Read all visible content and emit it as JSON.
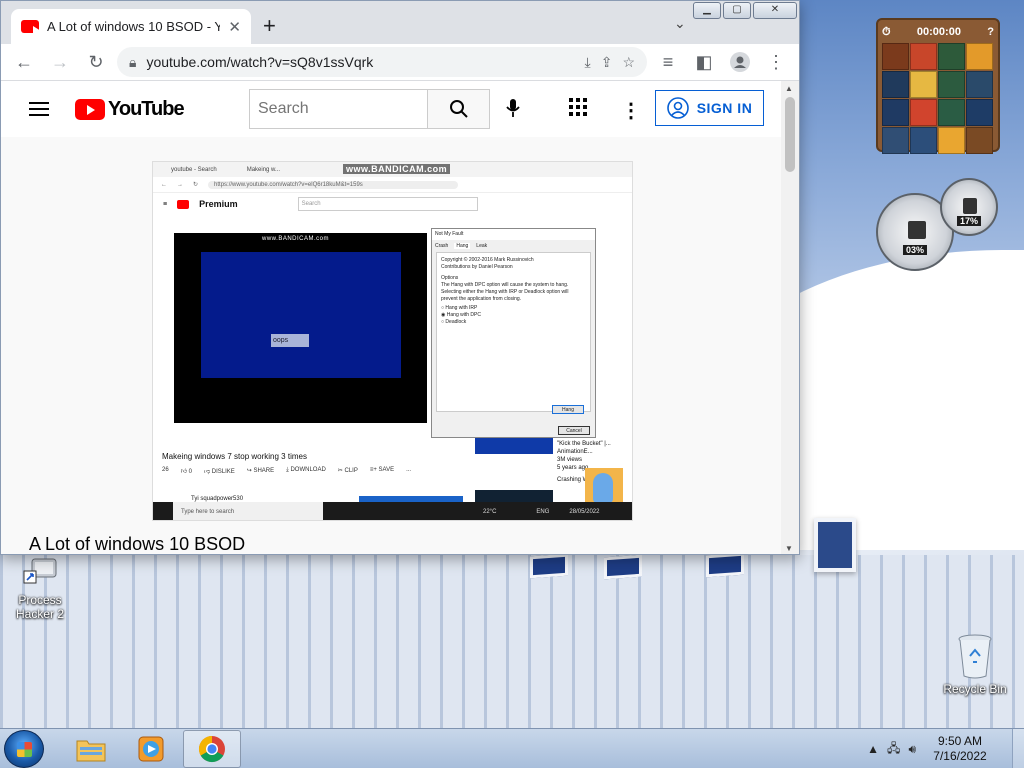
{
  "browser": {
    "tab_title": "A Lot of windows 10 BSOD - You",
    "tab_close": "✕",
    "new_tab": "+",
    "url": "youtube.com/watch?v=sQ8v1ssVqrk",
    "window_controls": {
      "minimize": "▁",
      "maximize": "▢",
      "close": "✕"
    }
  },
  "youtube": {
    "logo_text": "YouTube",
    "search_placeholder": "Search",
    "sign_in": "SIGN IN",
    "video_title": "A Lot of windows 10 BSOD"
  },
  "video_frame": {
    "watermark_top": "www.BANDICAM.com",
    "watermark_player": "www.BANDICAM.com",
    "tab1": "youtube - Search",
    "tab2": "Makeing w...",
    "inner_url": "https://www.youtube.com/watch?v=elQ6r18kuM&t=159s",
    "premium": "Premium",
    "inner_search": "Search",
    "oops": "oops",
    "dialog_title": "Not My Fault",
    "dialog_tabs": [
      "Crash",
      "Hang",
      "Leak"
    ],
    "dialog_text1": "Copyright © 2002-2016 Mark Russinovich",
    "dialog_text2": "Contributions by Daniel Pearson",
    "dialog_options": "Options",
    "dialog_desc": "The Hang with DPC option will cause the system to hang. Selecting either the Hang with IRP or Deadlock option will prevent the application from closing.",
    "dialog_radio1": "Hang with IRP",
    "dialog_radio2": "Hang with DPC",
    "dialog_radio3": "Deadlock",
    "dialog_hang_btn": "Hang",
    "dialog_cancel_btn": "Cancel",
    "caption": "Makeing windows 7 stop working 3 times",
    "actions": [
      "26",
      "0",
      "DISLIKE",
      "SHARE",
      "DOWNLOAD",
      "CLIP",
      "SAVE",
      "..."
    ],
    "side_text": "\"Kick the Bucket\" |...",
    "side_channel": "AnimationE...",
    "side_views": "3M views",
    "side_age": "5 years ago",
    "side_next": "Crashing Windows...",
    "channel": "Tyi squadpower530",
    "inner_taskbar_search": "Type here to search",
    "inner_weather": "22°C",
    "inner_lang": "ENG",
    "inner_clock": "28/05/2022"
  },
  "gadgets": {
    "puzzle_timer": "00:00:00",
    "cpu_value": "03%",
    "mem_value": "17%",
    "puzzle_colors": [
      "#7b3a1c",
      "#c8462a",
      "#2d5a3a",
      "#e39a2a",
      "#203a5c",
      "#e6b842",
      "#2c5b3f",
      "#2a4a6a",
      "#1f3a63",
      "#d1442d",
      "#2a5c44",
      "#1e3c66",
      "#304e74",
      "#2c4e7a",
      "#e9a630",
      "#7a4a24"
    ]
  },
  "desktop": {
    "icon_process_hacker": "Process Hacker 2",
    "icon_recycle_bin": "Recycle Bin"
  },
  "taskbar": {
    "time": "9:50 AM",
    "date": "7/16/2022"
  }
}
